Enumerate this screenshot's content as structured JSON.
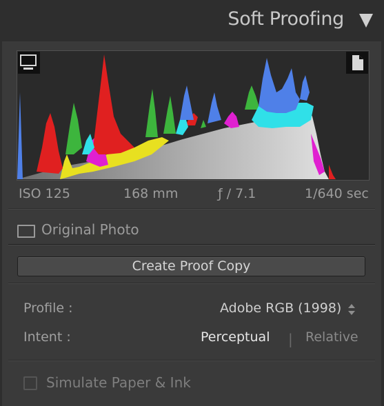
{
  "panel": {
    "title": "Soft Proofing"
  },
  "histogram": {
    "channel_colors": {
      "red": "#e02020",
      "green": "#3db53d",
      "blue": "#4f80e8",
      "cyan": "#30e0e8",
      "magenta": "#e020d0",
      "yellow": "#e8e020",
      "luminance": "#d0d0d0"
    }
  },
  "exif": {
    "iso": "ISO 125",
    "focal_length": "168 mm",
    "aperture": "ƒ / 7.1",
    "shutter": "1/640 sec"
  },
  "original_photo": {
    "label": "Original Photo",
    "checked": false
  },
  "create_proof_copy": {
    "label": "Create Proof Copy"
  },
  "profile": {
    "label": "Profile :",
    "value": "Adobe RGB (1998)"
  },
  "intent": {
    "label": "Intent :",
    "options": [
      "Perceptual",
      "Relative"
    ],
    "selected": "Perceptual",
    "separator": "|"
  },
  "simulate_paper_ink": {
    "label": "Simulate Paper & Ink",
    "checked": false
  }
}
